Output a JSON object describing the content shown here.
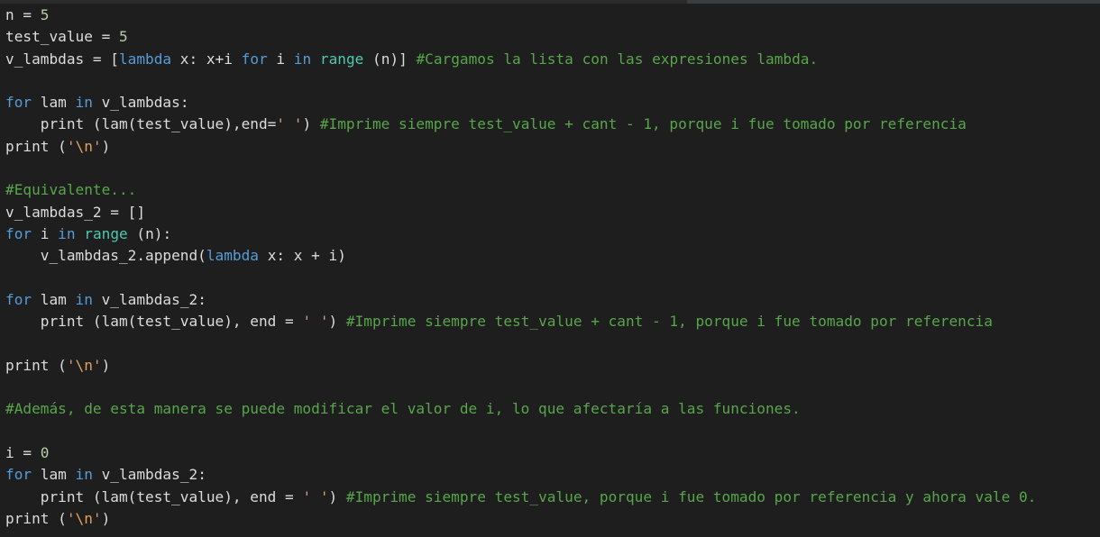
{
  "editor": {
    "language": "python",
    "background": "#1e1e1e",
    "colors": {
      "text": "#dcdcdc",
      "keyword": "#569cd6",
      "builtin": "#4ec9b0",
      "comment": "#57a64a",
      "string": "#d69d85",
      "escape": "#e2a25a",
      "number": "#b5cea8"
    },
    "lines": [
      {
        "tokens": [
          {
            "t": "pl",
            "v": "n = "
          },
          {
            "t": "nu",
            "v": "5"
          }
        ]
      },
      {
        "tokens": [
          {
            "t": "pl",
            "v": "test_value = "
          },
          {
            "t": "nu",
            "v": "5"
          }
        ]
      },
      {
        "tokens": [
          {
            "t": "pl",
            "v": "v_lambdas = ["
          },
          {
            "t": "kw",
            "v": "lambda"
          },
          {
            "t": "pl",
            "v": " x: x+i "
          },
          {
            "t": "kw",
            "v": "for"
          },
          {
            "t": "pl",
            "v": " i "
          },
          {
            "t": "kw",
            "v": "in"
          },
          {
            "t": "pl",
            "v": " "
          },
          {
            "t": "bi",
            "v": "range"
          },
          {
            "t": "pl",
            "v": " (n)] "
          },
          {
            "t": "cm",
            "v": "#Cargamos la lista con las expresiones lambda."
          }
        ]
      },
      {
        "tokens": []
      },
      {
        "tokens": [
          {
            "t": "kw",
            "v": "for"
          },
          {
            "t": "pl",
            "v": " lam "
          },
          {
            "t": "kw",
            "v": "in"
          },
          {
            "t": "pl",
            "v": " v_lambdas:"
          }
        ]
      },
      {
        "tokens": [
          {
            "t": "pl",
            "v": "    print (lam(test_value),end="
          },
          {
            "t": "st",
            "v": "' '"
          },
          {
            "t": "pl",
            "v": ") "
          },
          {
            "t": "cm",
            "v": "#Imprime siempre test_value + cant - 1, porque i fue tomado por referencia"
          }
        ]
      },
      {
        "tokens": [
          {
            "t": "pl",
            "v": "print ("
          },
          {
            "t": "st",
            "v": "'"
          },
          {
            "t": "es",
            "v": "\\n"
          },
          {
            "t": "st",
            "v": "'"
          },
          {
            "t": "pl",
            "v": ")"
          }
        ]
      },
      {
        "tokens": []
      },
      {
        "tokens": [
          {
            "t": "cm",
            "v": "#Equivalente..."
          }
        ]
      },
      {
        "tokens": [
          {
            "t": "pl",
            "v": "v_lambdas_2 = []"
          }
        ]
      },
      {
        "tokens": [
          {
            "t": "kw",
            "v": "for"
          },
          {
            "t": "pl",
            "v": " i "
          },
          {
            "t": "kw",
            "v": "in"
          },
          {
            "t": "pl",
            "v": " "
          },
          {
            "t": "bi",
            "v": "range"
          },
          {
            "t": "pl",
            "v": " (n):"
          }
        ]
      },
      {
        "tokens": [
          {
            "t": "pl",
            "v": "    v_lambdas_2.append("
          },
          {
            "t": "kw",
            "v": "lambda"
          },
          {
            "t": "pl",
            "v": " x: x + i)"
          }
        ]
      },
      {
        "tokens": []
      },
      {
        "tokens": [
          {
            "t": "kw",
            "v": "for"
          },
          {
            "t": "pl",
            "v": " lam "
          },
          {
            "t": "kw",
            "v": "in"
          },
          {
            "t": "pl",
            "v": " v_lambdas_2:"
          }
        ]
      },
      {
        "tokens": [
          {
            "t": "pl",
            "v": "    print (lam(test_value), end = "
          },
          {
            "t": "st",
            "v": "' '"
          },
          {
            "t": "pl",
            "v": ") "
          },
          {
            "t": "cm",
            "v": "#Imprime siempre test_value + cant - 1, porque i fue tomado por referencia"
          }
        ]
      },
      {
        "tokens": []
      },
      {
        "tokens": [
          {
            "t": "pl",
            "v": "print ("
          },
          {
            "t": "st",
            "v": "'"
          },
          {
            "t": "es",
            "v": "\\n"
          },
          {
            "t": "st",
            "v": "'"
          },
          {
            "t": "pl",
            "v": ")"
          }
        ]
      },
      {
        "tokens": []
      },
      {
        "tokens": [
          {
            "t": "cm",
            "v": "#Además, de esta manera se puede modificar el valor de i, lo que afectaría a las funciones."
          }
        ]
      },
      {
        "tokens": []
      },
      {
        "tokens": [
          {
            "t": "pl",
            "v": "i = "
          },
          {
            "t": "nu",
            "v": "0"
          }
        ]
      },
      {
        "tokens": [
          {
            "t": "kw",
            "v": "for"
          },
          {
            "t": "pl",
            "v": " lam "
          },
          {
            "t": "kw",
            "v": "in"
          },
          {
            "t": "pl",
            "v": " v_lambdas_2:"
          }
        ]
      },
      {
        "tokens": [
          {
            "t": "pl",
            "v": "    print (lam(test_value), end = "
          },
          {
            "t": "st",
            "v": "' '"
          },
          {
            "t": "pl",
            "v": ") "
          },
          {
            "t": "cm",
            "v": "#Imprime siempre test_value, porque i fue tomado por referencia y ahora vale 0."
          }
        ]
      },
      {
        "tokens": [
          {
            "t": "pl",
            "v": "print ("
          },
          {
            "t": "st",
            "v": "'"
          },
          {
            "t": "es",
            "v": "\\n"
          },
          {
            "t": "st",
            "v": "'"
          },
          {
            "t": "pl",
            "v": ")"
          }
        ]
      }
    ]
  }
}
